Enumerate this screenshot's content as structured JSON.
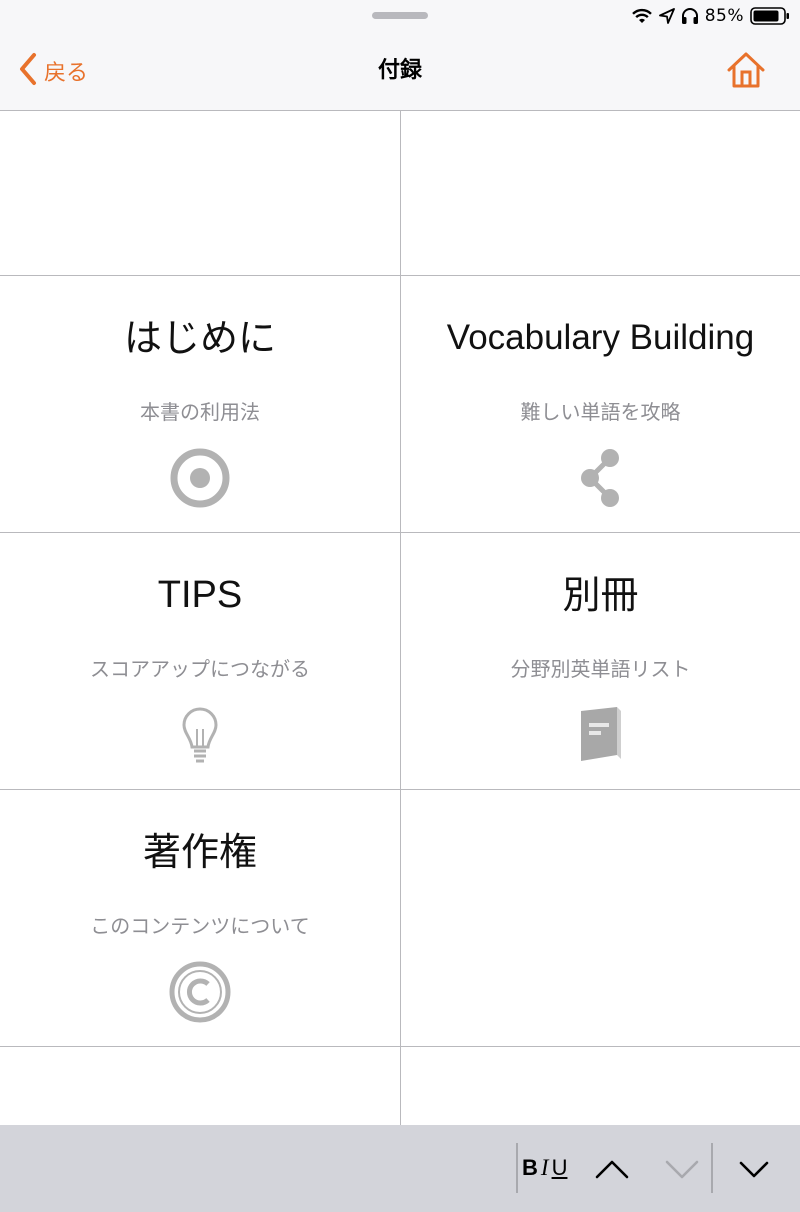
{
  "status_bar": {
    "battery_percent": "85%",
    "icons": [
      "wifi-icon",
      "location-arrow-icon",
      "headphones-icon",
      "battery-icon"
    ]
  },
  "nav": {
    "back_label": "戻る",
    "title": "付録",
    "home_icon": "home-icon",
    "accent_color": "#e8722c"
  },
  "grid": {
    "items": [
      {
        "title": "はじめに",
        "subtitle": "本書の利用法",
        "icon": "target-icon"
      },
      {
        "title": "Vocabulary Building",
        "subtitle": "難しい単語を攻略",
        "icon": "share-icon"
      },
      {
        "title": "TIPS",
        "subtitle": "スコアアップにつながる",
        "icon": "lightbulb-icon"
      },
      {
        "title": "別冊",
        "subtitle": "分野別英単語リスト",
        "icon": "book-icon"
      },
      {
        "title": "著作権",
        "subtitle": "このコンテンツについて",
        "icon": "copyright-icon"
      }
    ]
  },
  "toolbar": {
    "bold": "B",
    "italic": "I",
    "underline": "U",
    "buttons": [
      "chevron-up-icon",
      "chevron-down-disabled-icon",
      "chevron-down-icon"
    ]
  }
}
